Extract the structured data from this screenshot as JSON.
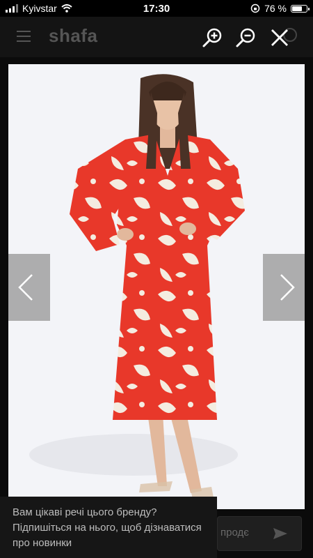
{
  "status_bar": {
    "carrier": "Kyivstar",
    "time": "17:30",
    "battery": "76 %",
    "battery_level": 0.76
  },
  "app": {
    "logo": "shafa"
  },
  "viewer": {
    "icons": {
      "zoom_in": "zoom-in-icon",
      "zoom_out": "zoom-out-icon",
      "close": "close-icon",
      "prev": "chevron-left-icon",
      "next": "chevron-right-icon"
    }
  },
  "promo": {
    "text": "Вам цікаві речі цього бренду? Підпишіться на нього, щоб дізнаватися про новинки"
  },
  "subscribe": {
    "placeholder": "продє"
  },
  "colors": {
    "dress_red": "#e8382a",
    "dress_cream": "#f4ece0",
    "backdrop": "#f3f4f8",
    "overlay": "#0b0b0b"
  }
}
